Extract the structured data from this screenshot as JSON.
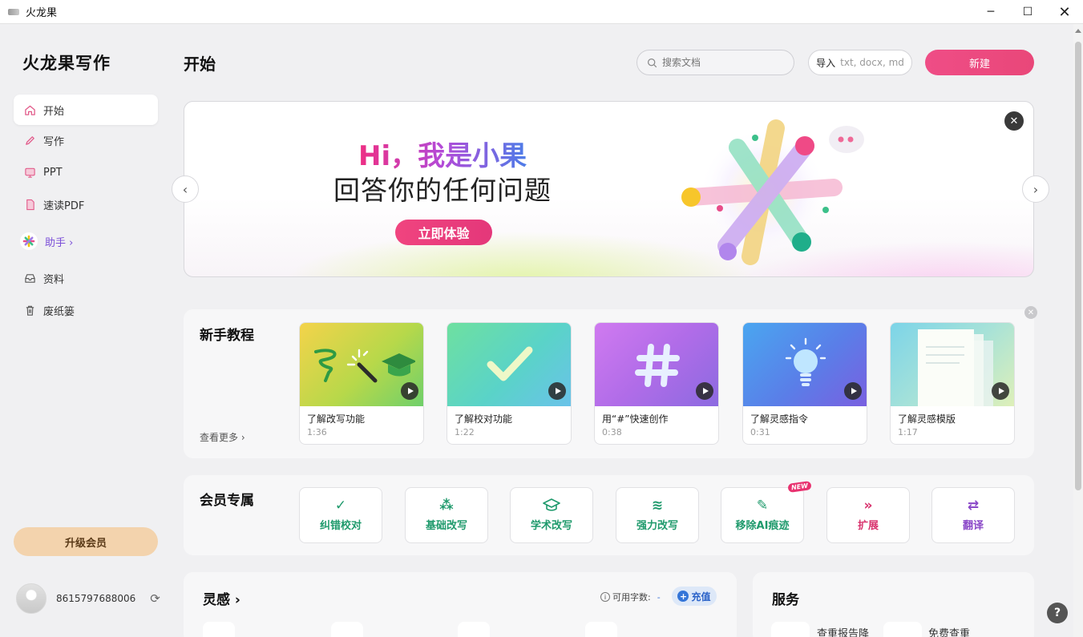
{
  "window": {
    "title": "火龙果"
  },
  "sidebar": {
    "logo": "火龙果写作",
    "items": [
      {
        "label": "开始",
        "icon": "home-icon",
        "active": true
      },
      {
        "label": "写作",
        "icon": "pencil-icon"
      },
      {
        "label": "PPT",
        "icon": "ppt-icon"
      },
      {
        "label": "速读PDF",
        "icon": "pdf-icon"
      },
      {
        "label": "助手 ›",
        "icon": "assistant-icon"
      },
      {
        "label": "资料",
        "icon": "inbox-icon"
      },
      {
        "label": "废纸篓",
        "icon": "trash-icon"
      }
    ],
    "upgrade_label": "升级会员",
    "user_phone": "8615797688006"
  },
  "header": {
    "title": "开始",
    "search_placeholder": "搜索文档",
    "import_label": "导入",
    "import_formats": "txt, docx, md",
    "new_label": "新建"
  },
  "banner": {
    "line1": "Hi，我是小果",
    "line2": "回答你的任何问题",
    "cta": "立即体验"
  },
  "tutorials": {
    "title": "新手教程",
    "see_more": "查看更多 ›",
    "videos": [
      {
        "title": "了解改写功能",
        "duration": "1:36",
        "icon": "rewrite-icon"
      },
      {
        "title": "了解校对功能",
        "duration": "1:22",
        "icon": "check-icon"
      },
      {
        "title": "用“#”快速创作",
        "duration": "0:38",
        "icon": "hash-icon"
      },
      {
        "title": "了解灵感指令",
        "duration": "0:31",
        "icon": "bulb-icon"
      },
      {
        "title": "了解灵感模版",
        "duration": "1:17",
        "icon": "template-icon"
      }
    ]
  },
  "vip": {
    "title": "会员专属",
    "new_badge": "NEW",
    "tools": [
      {
        "label": "纠错校对",
        "color": "#1f9a6c",
        "glyph": "✓"
      },
      {
        "label": "基础改写",
        "color": "#1f9a6c",
        "glyph": "⁂"
      },
      {
        "label": "学术改写",
        "color": "#1f9a6c",
        "glyph": "🎓"
      },
      {
        "label": "强力改写",
        "color": "#1f9a6c",
        "glyph": "≋"
      },
      {
        "label": "移除AI痕迹",
        "color": "#1f9a6c",
        "glyph": "✎"
      },
      {
        "label": "扩展",
        "color": "#d9356f",
        "glyph": "»"
      },
      {
        "label": "翻译",
        "color": "#8a48c8",
        "glyph": "⇄"
      }
    ]
  },
  "inspiration": {
    "title": "灵感 ›",
    "available_label": "可用字数:",
    "available_value": "-",
    "recharge_label": "充值"
  },
  "services": {
    "title": "服务",
    "item1": "查重报告降",
    "item2": "免费查重"
  }
}
